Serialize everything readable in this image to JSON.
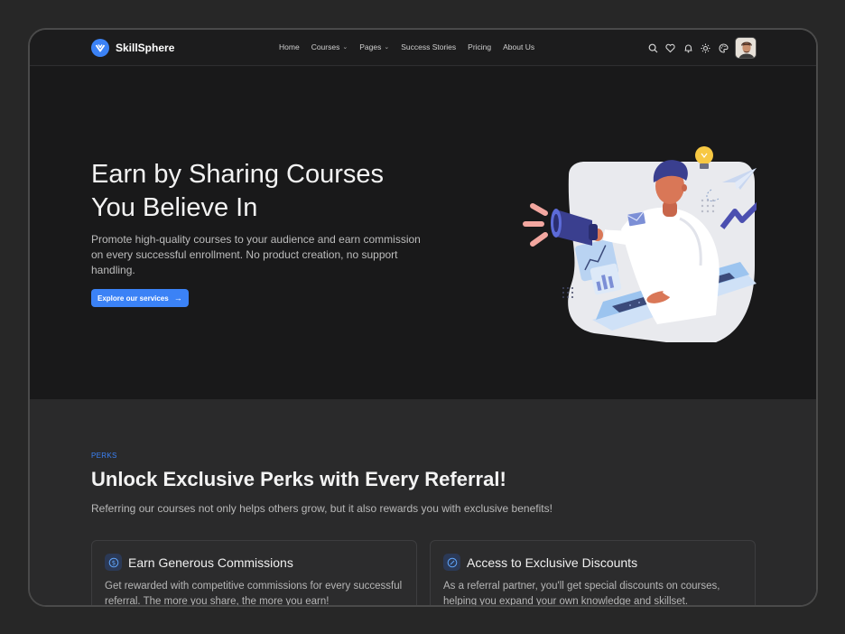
{
  "brand": {
    "name": "SkillSphere",
    "accent": "#3b82f6"
  },
  "nav": {
    "items": [
      {
        "label": "Home",
        "dropdown": false
      },
      {
        "label": "Courses",
        "dropdown": true
      },
      {
        "label": "Pages",
        "dropdown": true
      },
      {
        "label": "Success Stories",
        "dropdown": false
      },
      {
        "label": "Pricing",
        "dropdown": false
      },
      {
        "label": "About Us",
        "dropdown": false
      }
    ],
    "icons": [
      "search-icon",
      "heart-icon",
      "bell-icon",
      "sun-icon",
      "palette-icon"
    ]
  },
  "hero": {
    "title_line1": "Earn by Sharing Courses",
    "title_line2": "You Believe In",
    "description": "Promote high-quality courses to your audience and earn commission on every successful enrollment. No product creation, no support handling.",
    "button_label": "Explore our services"
  },
  "perks": {
    "kicker": "PERKS",
    "title": "Unlock Exclusive Perks with Every Referral!",
    "subtitle": "Referring our courses not only helps others grow, but it also rewards you with exclusive benefits!",
    "cards": [
      {
        "icon": "dollar-icon",
        "title": "Earn Generous Commissions",
        "text": "Get rewarded with competitive commissions for every successful referral. The more you share, the more you earn!"
      },
      {
        "icon": "discount-icon",
        "title": "Access to Exclusive Discounts",
        "text": "As a referral partner, you'll get special discounts on courses, helping you expand your own knowledge and skillset."
      }
    ]
  }
}
